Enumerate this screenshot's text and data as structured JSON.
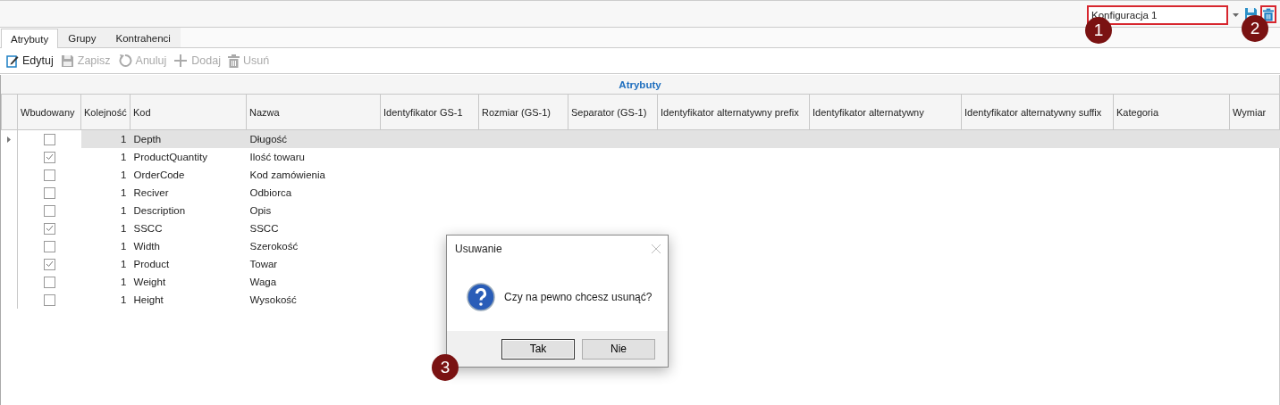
{
  "config_selector": {
    "value": "Konfiguracja 1"
  },
  "tabs": [
    {
      "label": "Atrybuty",
      "selected": true
    },
    {
      "label": "Grupy",
      "selected": false
    },
    {
      "label": "Kontrahenci",
      "selected": false
    }
  ],
  "toolbar": [
    {
      "label": "Edytuj",
      "disabled": false
    },
    {
      "label": "Zapisz",
      "disabled": true
    },
    {
      "label": "Anuluj",
      "disabled": true
    },
    {
      "label": "Dodaj",
      "disabled": true
    },
    {
      "label": "Usuń",
      "disabled": true
    }
  ],
  "table": {
    "caption": "Atrybuty",
    "columns": [
      "Wbudowany",
      "Kolejność",
      "Kod",
      "Nazwa",
      "Identyfikator GS-1",
      "Rozmiar (GS-1)",
      "Separator (GS-1)",
      "Identyfikator alternatywny prefix",
      "Identyfikator alternatywny",
      "Identyfikator alternatywny suffix",
      "Kategoria",
      "Wymiar"
    ],
    "rows": [
      {
        "checked": false,
        "order": "1",
        "code": "Depth",
        "name": "Długość",
        "selected": true
      },
      {
        "checked": true,
        "order": "1",
        "code": "ProductQuantity",
        "name": "Ilość towaru",
        "selected": false
      },
      {
        "checked": false,
        "order": "1",
        "code": "OrderCode",
        "name": "Kod zamówienia",
        "selected": false
      },
      {
        "checked": false,
        "order": "1",
        "code": "Reciver",
        "name": "Odbiorca",
        "selected": false
      },
      {
        "checked": false,
        "order": "1",
        "code": "Description",
        "name": "Opis",
        "selected": false
      },
      {
        "checked": true,
        "order": "1",
        "code": "SSCC",
        "name": "SSCC",
        "selected": false
      },
      {
        "checked": false,
        "order": "1",
        "code": "Width",
        "name": "Szerokość",
        "selected": false
      },
      {
        "checked": true,
        "order": "1",
        "code": "Product",
        "name": "Towar",
        "selected": false
      },
      {
        "checked": false,
        "order": "1",
        "code": "Weight",
        "name": "Waga",
        "selected": false
      },
      {
        "checked": false,
        "order": "1",
        "code": "Height",
        "name": "Wysokość",
        "selected": false
      }
    ]
  },
  "dialog": {
    "title": "Usuwanie",
    "message": "Czy na pewno chcesz usunąć?",
    "buttons": [
      "Tak",
      "Nie"
    ]
  },
  "callouts": [
    "1",
    "2",
    "3"
  ]
}
